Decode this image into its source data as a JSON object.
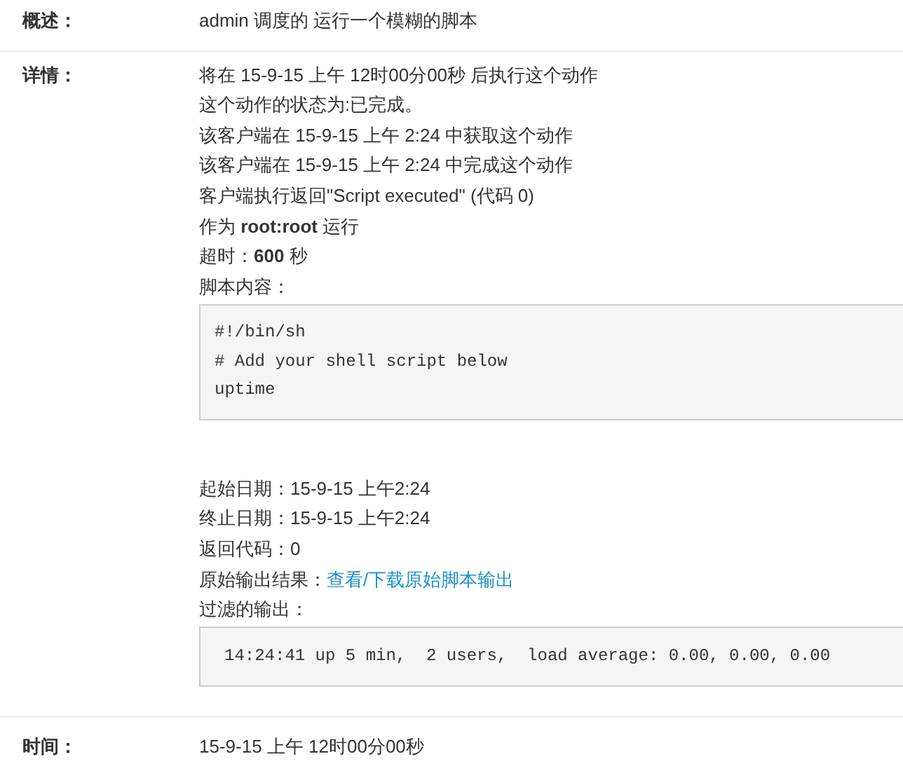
{
  "summary": {
    "label": "概述：",
    "value": "admin 调度的 运行一个模糊的脚本"
  },
  "details": {
    "label": "详情：",
    "lines": [
      "将在 15-9-15 上午 12时00分00秒 后执行这个动作",
      "这个动作的状态为:已完成。",
      "该客户端在 15-9-15 上午 2:24 中获取这个动作",
      "该客户端在 15-9-15 上午 2:24 中完成这个动作",
      "客户端执行返回\"Script executed\" (代码 0)",
      "作为 **root:root** 运行",
      "超时：**600** 秒"
    ],
    "script_label": "脚本内容：",
    "script": [
      "#!/bin/sh",
      "# Add your shell script below",
      "uptime"
    ],
    "result_lines": [
      "起始日期：15-9-15 上午2:24",
      "终止日期：15-9-15 上午2:24",
      "返回代码：0"
    ],
    "raw_output": {
      "label": "原始输出结果：",
      "link": "查看/下载原始脚本输出"
    },
    "filtered_label": "过滤的输出：",
    "filtered_output": "14:24:41 up 5 min,  2 users,  load average: 0.00, 0.00, 0.00"
  },
  "time": {
    "label": "时间：",
    "value": "15-9-15 上午 12时00分00秒"
  }
}
